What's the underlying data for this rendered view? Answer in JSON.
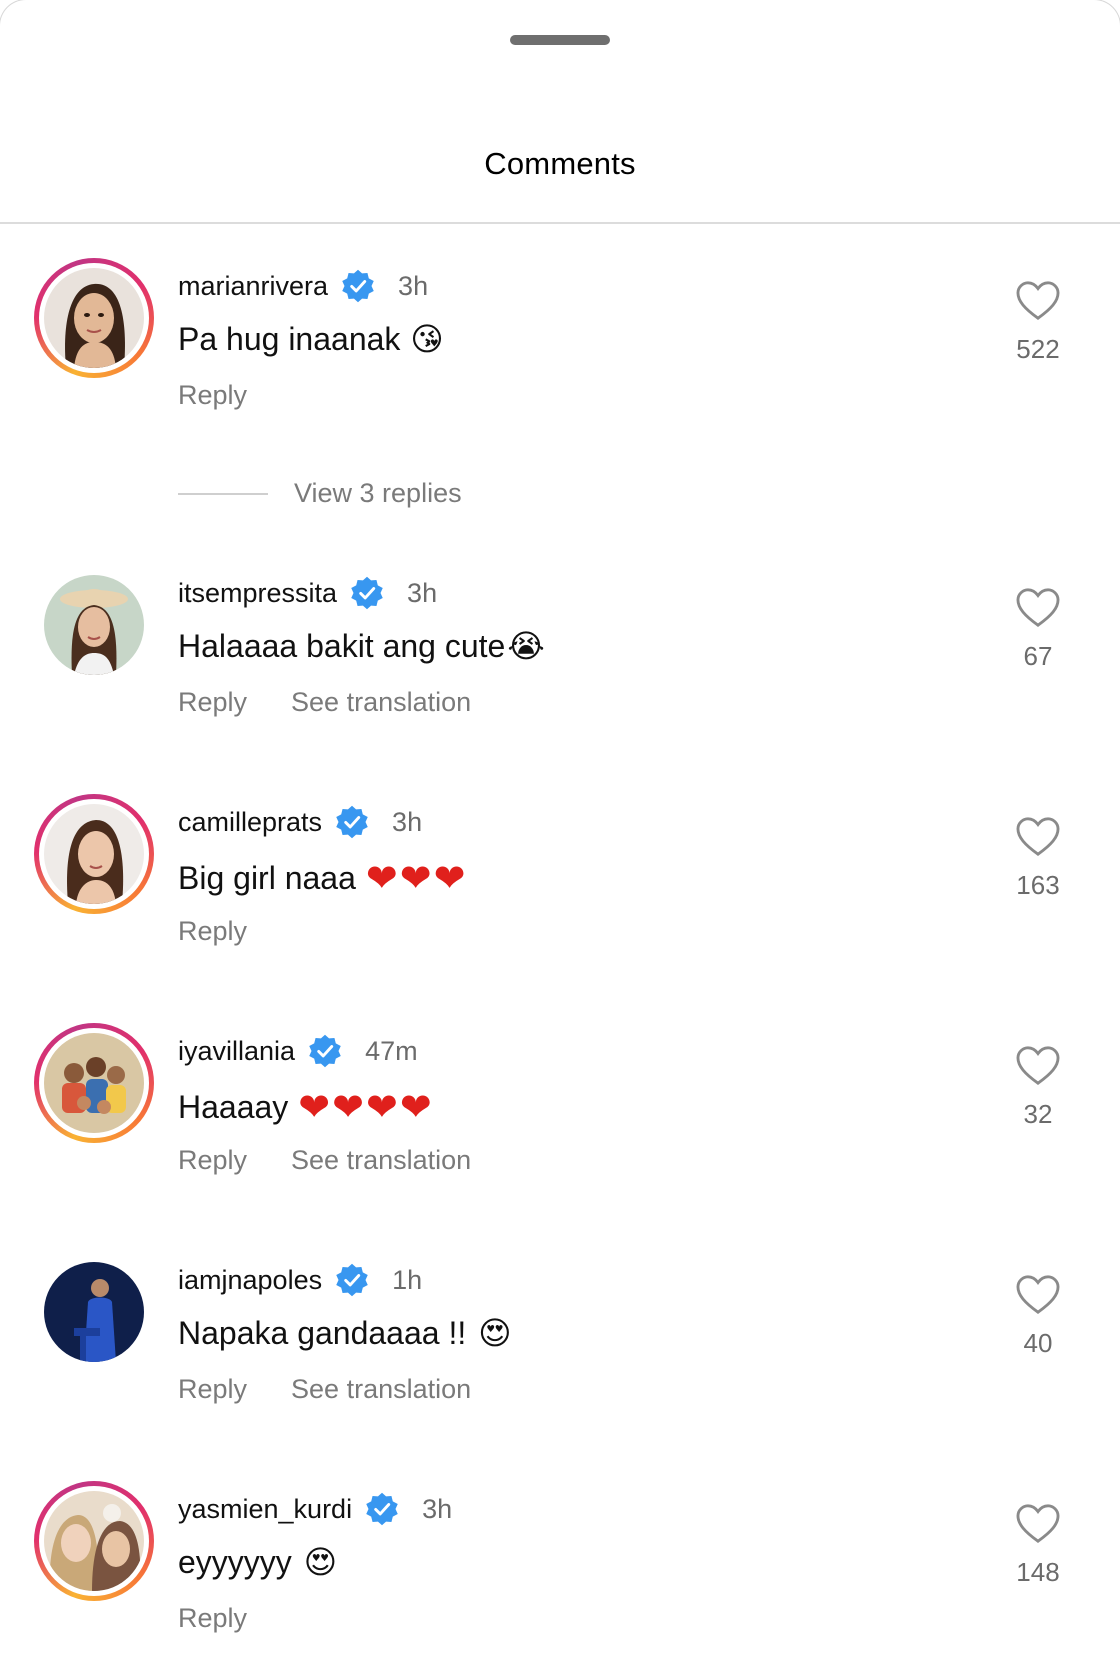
{
  "sheet": {
    "title": "Comments"
  },
  "replies_toggle": {
    "label": "View 3 replies"
  },
  "comments": [
    {
      "username": "marianrivera",
      "time": "3h",
      "text": "Pa hug inaanak",
      "emoji": "😘",
      "reply_label": "Reply",
      "translation_label": "",
      "likes": "522",
      "story_ring": true,
      "avatar_color": "#6b4a3a"
    },
    {
      "username": "itsempressita",
      "time": "3h",
      "text": "Halaaaa bakit ang cute",
      "emoji": "😭",
      "reply_label": "Reply",
      "translation_label": "See translation",
      "likes": "67",
      "story_ring": false,
      "avatar_color": "#c9a98a"
    },
    {
      "username": "camilleprats",
      "time": "3h",
      "text": "Big girl naaa",
      "emoji": "❤❤❤",
      "reply_label": "Reply",
      "translation_label": "",
      "likes": "163",
      "story_ring": true,
      "avatar_color": "#7a5a48"
    },
    {
      "username": "iyavillania",
      "time": "47m",
      "text": "Haaaay",
      "emoji": "❤❤❤❤",
      "reply_label": "Reply",
      "translation_label": "See translation",
      "likes": "32",
      "story_ring": true,
      "avatar_color": "#b89a6a"
    },
    {
      "username": "iamjnapoles",
      "time": "1h",
      "text": "Napaka gandaaaa !!",
      "emoji": "😍",
      "reply_label": "Reply",
      "translation_label": "See translation",
      "likes": "40",
      "story_ring": false,
      "avatar_color": "#1e3a8a"
    },
    {
      "username": "yasmien_kurdi",
      "time": "3h",
      "text": "eyyyyyy",
      "emoji": "😍",
      "reply_label": "Reply",
      "translation_label": "",
      "likes": "148",
      "story_ring": true,
      "avatar_color": "#d8b89a"
    }
  ],
  "colors": {
    "verified_blue": "#3897f0",
    "muted_text": "#7a7a7a",
    "heart_red": "#e0201c"
  },
  "icons": {
    "like": "heart-outline-icon",
    "verified": "verified-badge-icon"
  }
}
